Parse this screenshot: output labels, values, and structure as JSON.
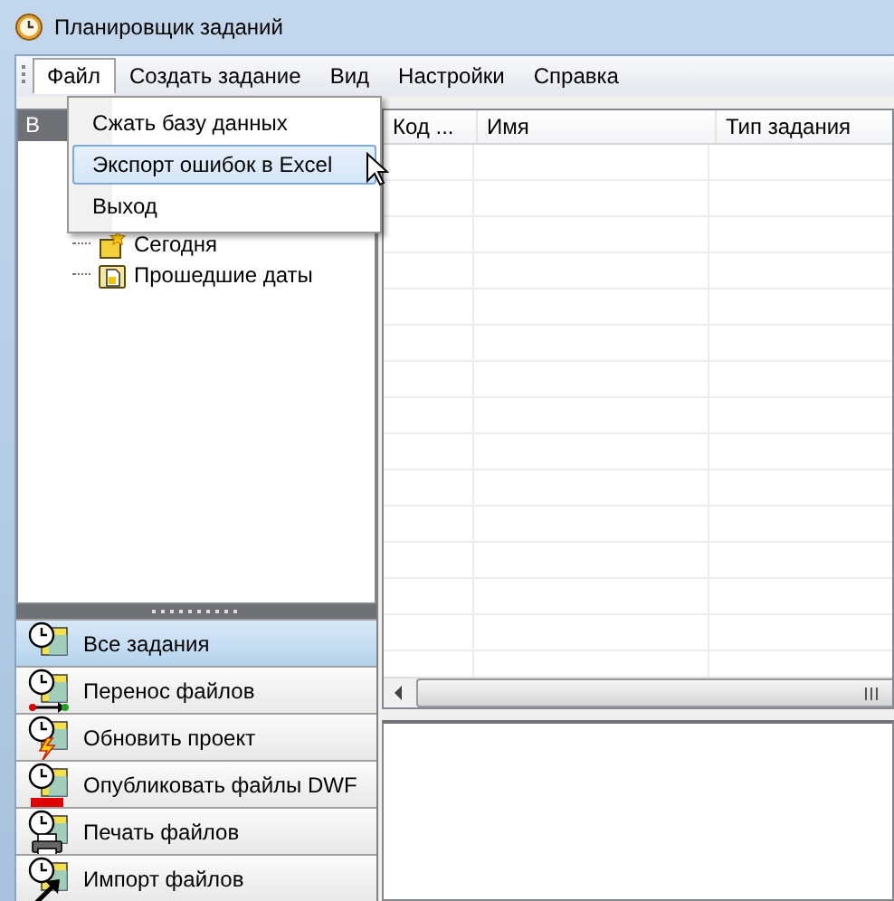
{
  "window": {
    "title": "Планировщик заданий"
  },
  "menu": [
    {
      "label": "Файл",
      "selected": true
    },
    {
      "label": "Создать задание",
      "selected": false
    },
    {
      "label": "Вид",
      "selected": false
    },
    {
      "label": "Настройки",
      "selected": false
    },
    {
      "label": "Справка",
      "selected": false
    }
  ],
  "dropdown": {
    "items": [
      {
        "label": "Сжать базу данных",
        "selected": false
      },
      {
        "label": "Экспорт ошибок в Excel",
        "selected": true
      },
      {
        "label": "Выход",
        "selected": false
      }
    ]
  },
  "left_panel": {
    "header": "В",
    "tree": [
      {
        "label": "Сегодня",
        "kind": "today"
      },
      {
        "label": "Прошедшие даты",
        "kind": "past"
      }
    ]
  },
  "task_types": [
    {
      "label": "Все задания",
      "selected": true,
      "kind": "all"
    },
    {
      "label": "Перенос файлов",
      "selected": false,
      "kind": "transfer"
    },
    {
      "label": "Обновить проект",
      "selected": false,
      "kind": "update"
    },
    {
      "label": "Опубликовать файлы DWF",
      "selected": false,
      "kind": "dwf"
    },
    {
      "label": "Печать файлов",
      "selected": false,
      "kind": "print"
    },
    {
      "label": "Импорт файлов",
      "selected": false,
      "kind": "import"
    }
  ],
  "table": {
    "columns": [
      "Код ...",
      "Имя",
      "Тип задания"
    ]
  }
}
